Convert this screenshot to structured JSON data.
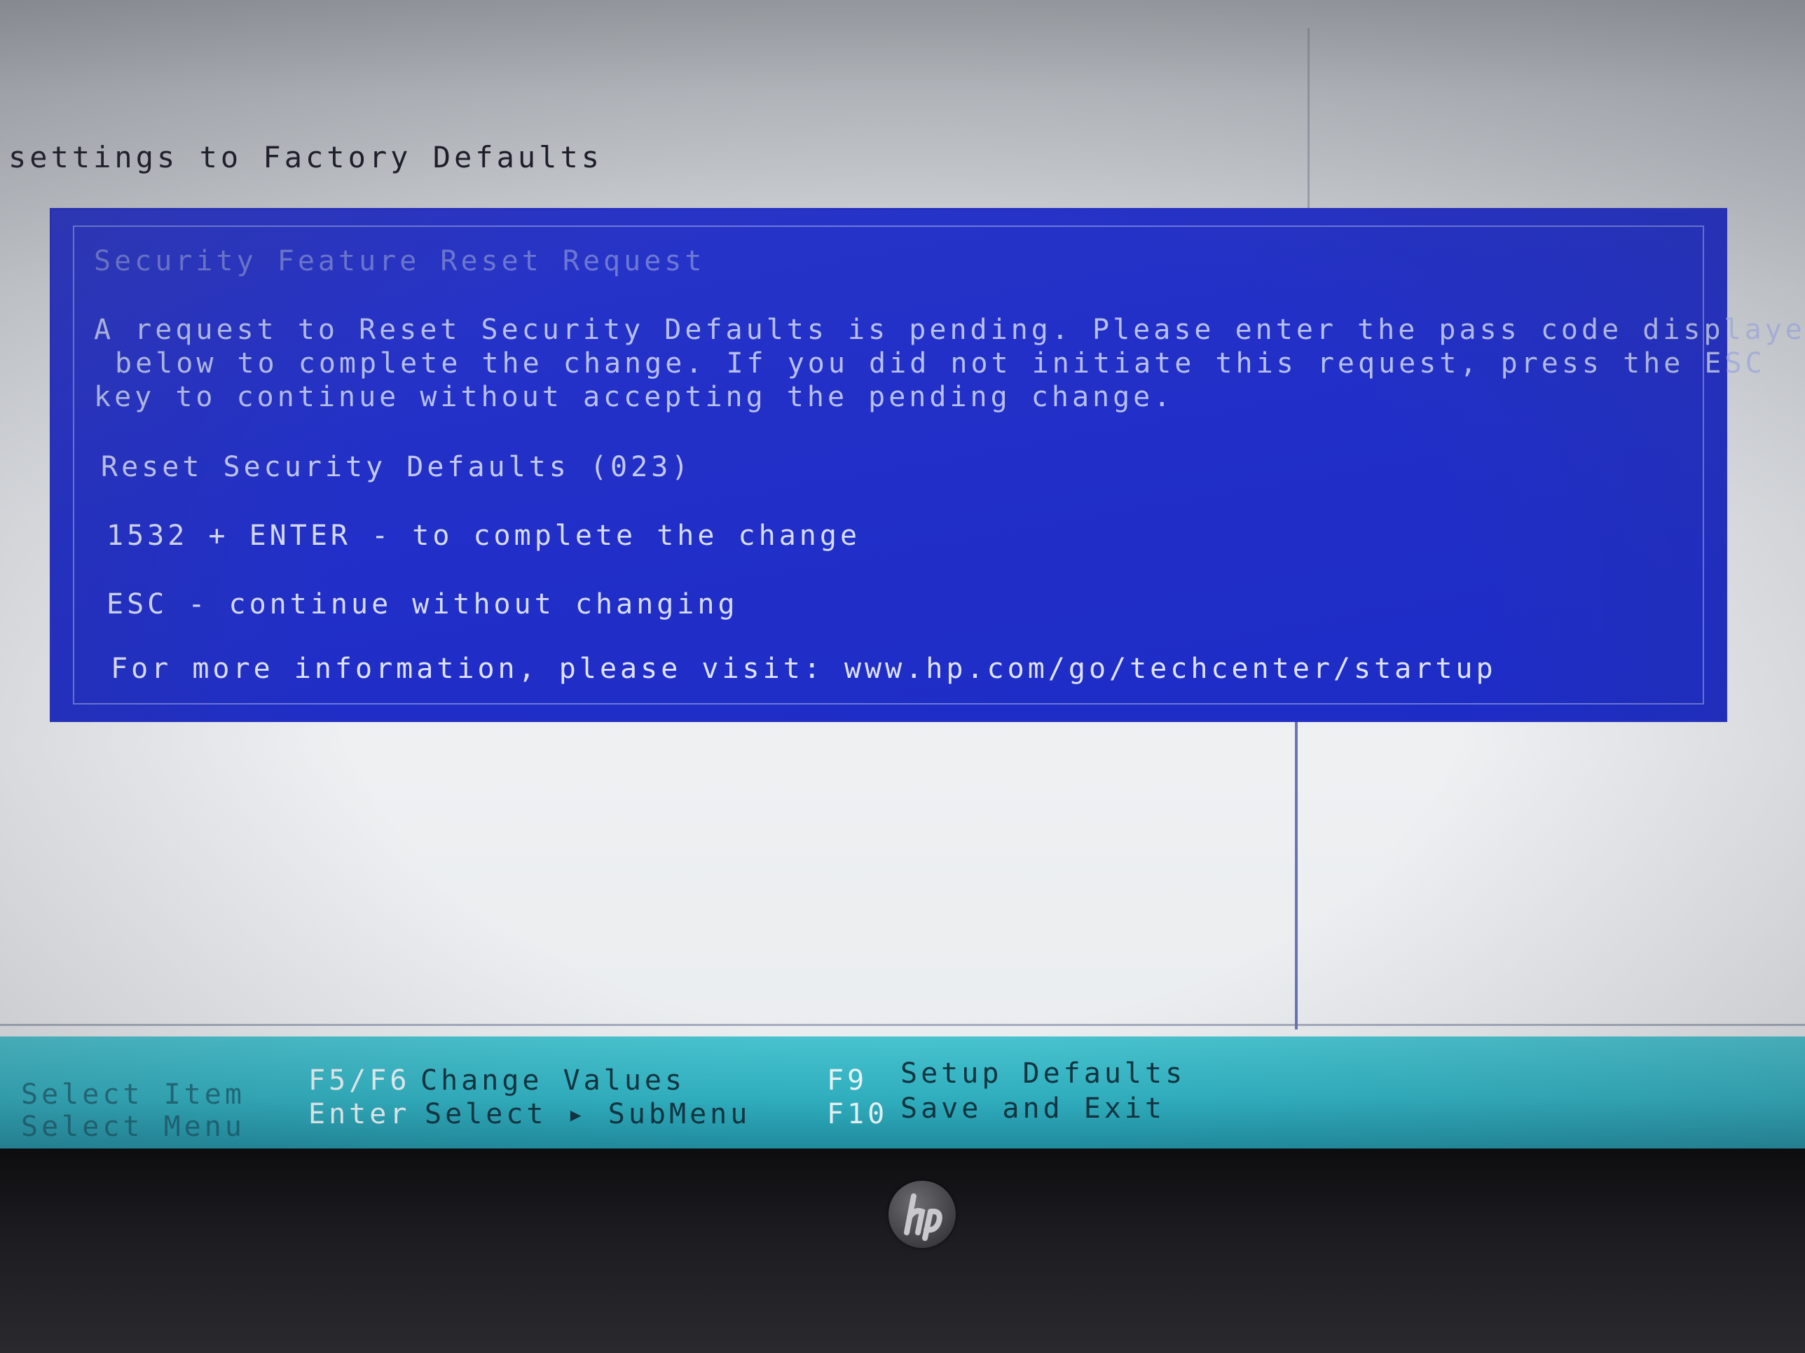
{
  "header": {
    "title": "settings to Factory Defaults"
  },
  "dialog": {
    "title": "Security Feature Reset Request",
    "message_lines": [
      "A request to Reset Security Defaults is pending. Please enter the pass code displayed",
      "below to complete the change. If you did not initiate this request, press the ESC",
      "key to continue without accepting the pending change."
    ],
    "reset_line": "Reset Security Defaults (023)",
    "code_line": "1532 + ENTER - to complete the change",
    "esc_line": "ESC - continue without changing",
    "info_line": "For more information, please visit: www.hp.com/go/techcenter/startup"
  },
  "footer": {
    "select_item": "Select Item",
    "select_menu": "Select Menu",
    "f5f6_key": "F5/F6",
    "f5f6_desc": "Change Values",
    "enter_key": "Enter",
    "enter_desc": "Select ▸ SubMenu",
    "f9_key": "F9",
    "f9_desc": "Setup Defaults",
    "f10_key": "F10",
    "f10_desc": "Save and Exit"
  },
  "colors": {
    "dialog_bg": "#2230c8",
    "dialog_text": "#c7cdf0",
    "footer_bg": "#2fb2c2",
    "screen_bg": "#e6e9ec"
  },
  "icons": {
    "bezel_logo": "hp-logo-icon"
  }
}
